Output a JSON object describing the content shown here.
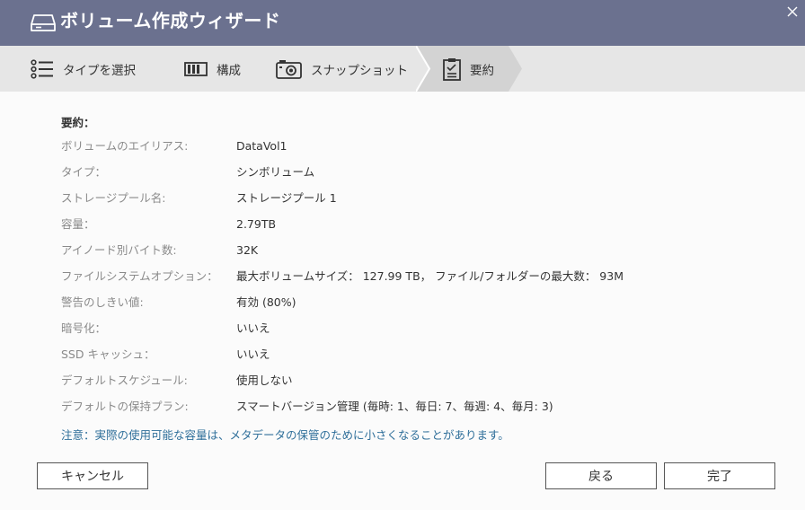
{
  "window": {
    "title": "ボリューム作成ウィザード"
  },
  "steps": [
    {
      "label": "タイプを選択",
      "icon": "list-icon",
      "active": false
    },
    {
      "label": "構成",
      "icon": "config-icon",
      "active": false
    },
    {
      "label": "スナップショット",
      "icon": "camera-icon",
      "active": false
    },
    {
      "label": "要約",
      "icon": "clipboard-check-icon",
      "active": true
    }
  ],
  "summary": {
    "heading": "要約：",
    "rows": [
      {
        "label": "ボリュームのエイリアス:",
        "value": "DataVol1"
      },
      {
        "label": "タイプ：",
        "value": "シンボリューム"
      },
      {
        "label": "ストレージプール名:",
        "value": "ストレージプール 1"
      },
      {
        "label": "容量：",
        "value": "2.79TB"
      },
      {
        "label": "アイノード別バイト数:",
        "value": "32K"
      },
      {
        "label": "ファイルシステムオプション：",
        "value": "最大ボリュームサイズ： 127.99 TB， ファイル/フォルダーの最大数： 93M"
      },
      {
        "label": "警告のしきい値:",
        "value": "有効 (80%)"
      },
      {
        "label": "暗号化：",
        "value": "いいえ"
      },
      {
        "label": "SSD キャッシュ：",
        "value": "いいえ"
      },
      {
        "label": "デフォルトスケジュール:",
        "value": "使用しない"
      },
      {
        "label": "デフォルトの保持プラン:",
        "value": "スマートバージョン管理 (毎時: 1、毎日: 7、毎週: 4、毎月: 3)"
      }
    ],
    "note": "注意：実際の使用可能な容量は、メタデータの保管のために小さくなることがあります。"
  },
  "buttons": {
    "cancel": "キャンセル",
    "back": "戻る",
    "finish": "完了"
  },
  "colors": {
    "titlebar": "#6b718f",
    "steps_bg": "#e6e6e6",
    "active_step": "#d3d3d3",
    "note": "#2f6f9a"
  }
}
